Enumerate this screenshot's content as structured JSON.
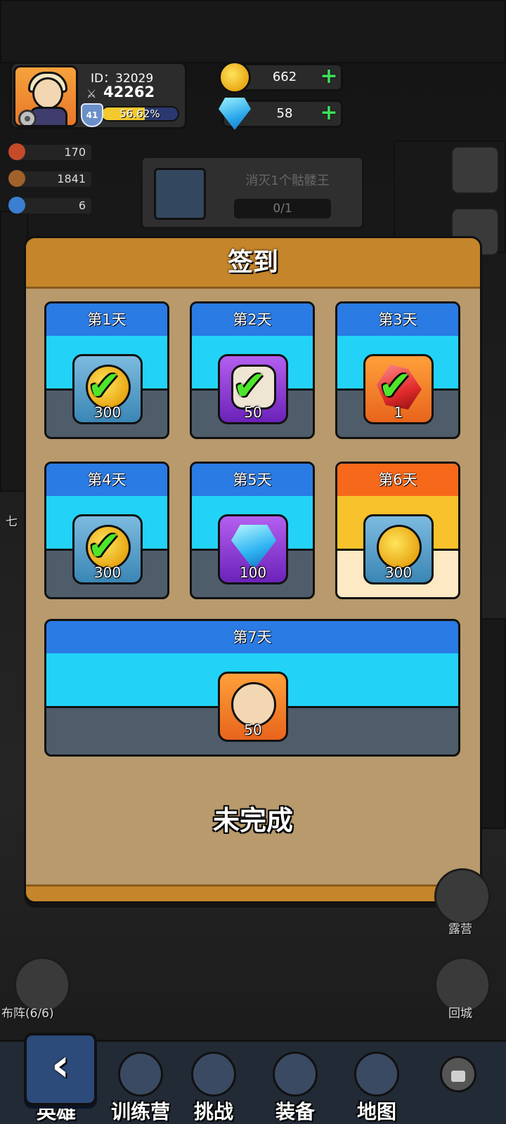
{
  "player": {
    "id_label": "ID：32029",
    "power": "42262",
    "level": "41",
    "exp_text": "56.62%",
    "exp_fraction": 0.5662
  },
  "currency": {
    "gold": "662",
    "diamond": "58",
    "plus": "+"
  },
  "resources": [
    "170",
    "1841",
    "6"
  ],
  "quest": {
    "text": "消灭1个骷髅王",
    "progress": "0/1"
  },
  "signin": {
    "title": "签到",
    "status": "未完成",
    "days": [
      {
        "label": "第1天",
        "reward": "gold-coin-icon",
        "amount": "300",
        "claimed": true
      },
      {
        "label": "第2天",
        "reward": "scroll-icon",
        "amount": "50",
        "claimed": true
      },
      {
        "label": "第3天",
        "reward": "ruby-icon",
        "amount": "1",
        "claimed": true
      },
      {
        "label": "第4天",
        "reward": "gold-coin-icon",
        "amount": "300",
        "claimed": true
      },
      {
        "label": "第5天",
        "reward": "diamond-icon",
        "amount": "100",
        "claimed": false
      },
      {
        "label": "第6天",
        "reward": "gold-coin-icon",
        "amount": "300",
        "claimed": false,
        "current": true
      },
      {
        "label": "第7天",
        "reward": "hero-shard-icon",
        "amount": "50",
        "claimed": false
      }
    ],
    "check_mark": "✔"
  },
  "map_buttons": {
    "formation": "布阵(6/6)",
    "camp": "露营",
    "return_city": "回城",
    "side_seven": "七"
  },
  "bottom_nav": {
    "back": "‹",
    "hero": "英雄",
    "training": "训练营",
    "challenge": "挑战",
    "equipment": "装备",
    "map": "地图"
  },
  "colors": {
    "dialog_bg": "#b89a6d",
    "header_orange": "#c4852b",
    "day_title_blue": "#2a7be4",
    "day_band_cyan": "#22d3f7",
    "today_title": "#f7691a",
    "check_green": "#4ee62a"
  }
}
